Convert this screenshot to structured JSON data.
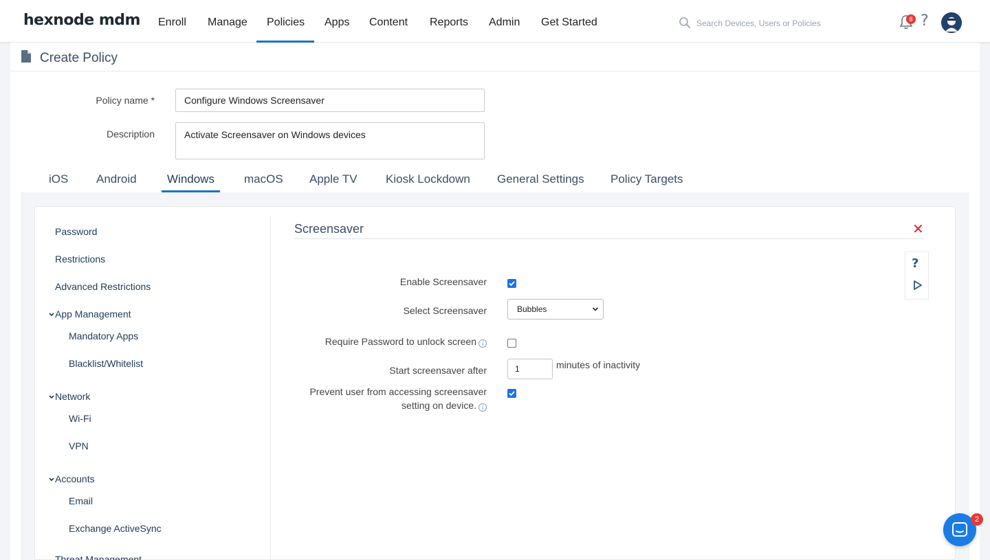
{
  "app": {
    "logo": "hexnode mdm"
  },
  "nav": {
    "items": [
      "Enroll",
      "Manage",
      "Policies",
      "Apps",
      "Content",
      "Reports",
      "Admin",
      "Get Started"
    ],
    "active": "Policies"
  },
  "search": {
    "placeholder": "Search Devices, Users or Policies"
  },
  "notifications": {
    "count": "8"
  },
  "help_glyph": "?",
  "page": {
    "title": "Create Policy"
  },
  "form": {
    "policy_name_label": "Policy name *",
    "policy_name_value": "Configure Windows Screensaver",
    "description_label": "Description",
    "description_value": "Activate Screensaver on Windows devices"
  },
  "tabs": [
    "iOS",
    "Android",
    "Windows",
    "macOS",
    "Apple TV",
    "Kiosk Lockdown",
    "General Settings",
    "Policy Targets"
  ],
  "active_tab": "Windows",
  "sidebar": {
    "items": [
      {
        "label": "Password"
      },
      {
        "label": "Restrictions"
      },
      {
        "label": "Advanced Restrictions"
      },
      {
        "label": "App Management"
      },
      {
        "label": "Mandatory Apps"
      },
      {
        "label": "Blacklist/Whitelist"
      },
      {
        "label": "Network"
      },
      {
        "label": "Wi-Fi"
      },
      {
        "label": "VPN"
      },
      {
        "label": "Accounts"
      },
      {
        "label": "Email"
      },
      {
        "label": "Exchange ActiveSync"
      },
      {
        "label": "Threat Management"
      }
    ]
  },
  "screensaver": {
    "title": "Screensaver",
    "close_glyph": "✕",
    "enable_label": "Enable Screensaver",
    "enable_checked": true,
    "select_label": "Select Screensaver",
    "select_value": "Bubbles",
    "require_password_label": "Require Password to unlock screen",
    "require_password_checked": false,
    "start_after_label": "Start screensaver after",
    "start_after_value": "1",
    "start_after_unit": "minutes of inactivity",
    "prevent_label_line1": "Prevent user from accessing screensaver",
    "prevent_label_line2": "setting on device.",
    "prevent_checked": true
  },
  "chat": {
    "badge": "2"
  },
  "colors": {
    "accent": "#1a73c6",
    "close": "#e0202a",
    "checkbox": "#1a73e8",
    "badge": "#e53935"
  }
}
